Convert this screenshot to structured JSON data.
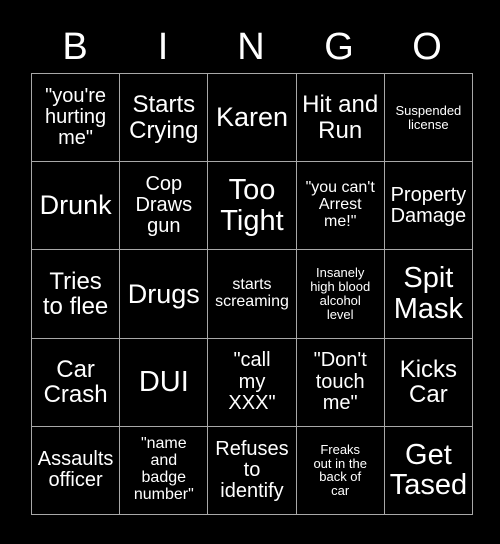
{
  "card": {
    "title": "BINGO",
    "background_color": "#000000",
    "text_color": "#ffffff",
    "border_color": "#a8a8a8"
  },
  "header": {
    "letters": [
      "B",
      "I",
      "N",
      "G",
      "O"
    ]
  },
  "grid": {
    "rows": 5,
    "columns": 5,
    "cells": [
      {
        "text": "\"you're\nhurting\nme\"",
        "size": "md"
      },
      {
        "text": "Starts\nCrying",
        "size": "lg"
      },
      {
        "text": "Karen",
        "size": "xl"
      },
      {
        "text": "Hit and\nRun",
        "size": "lg"
      },
      {
        "text": "Suspended\nlicense",
        "size": "xs"
      },
      {
        "text": "Drunk",
        "size": "xl"
      },
      {
        "text": "Cop\nDraws\ngun",
        "size": "md"
      },
      {
        "text": "Too\nTight",
        "size": "xxl"
      },
      {
        "text": "\"you can't\nArrest\nme!\"",
        "size": "sm"
      },
      {
        "text": "Property\nDamage",
        "size": "md"
      },
      {
        "text": "Tries\nto flee",
        "size": "lg"
      },
      {
        "text": "Drugs",
        "size": "xl"
      },
      {
        "text": "starts\nscreaming",
        "size": "sm"
      },
      {
        "text": "Insanely\nhigh blood\nalcohol\nlevel",
        "size": "xs"
      },
      {
        "text": "Spit\nMask",
        "size": "xxl"
      },
      {
        "text": "Car\nCrash",
        "size": "lg"
      },
      {
        "text": "DUI",
        "size": "xxl"
      },
      {
        "text": "\"call\nmy\nXXX\"",
        "size": "md"
      },
      {
        "text": "\"Don't\ntouch\nme\"",
        "size": "md"
      },
      {
        "text": "Kicks\nCar",
        "size": "lg"
      },
      {
        "text": "Assaults\nofficer",
        "size": "md"
      },
      {
        "text": "\"name\nand\nbadge\nnumber\"",
        "size": "sm"
      },
      {
        "text": "Refuses\nto\nidentify",
        "size": "md"
      },
      {
        "text": "Freaks\nout in the\nback of\ncar",
        "size": "xs"
      },
      {
        "text": "Get\nTased",
        "size": "xxl"
      }
    ]
  }
}
